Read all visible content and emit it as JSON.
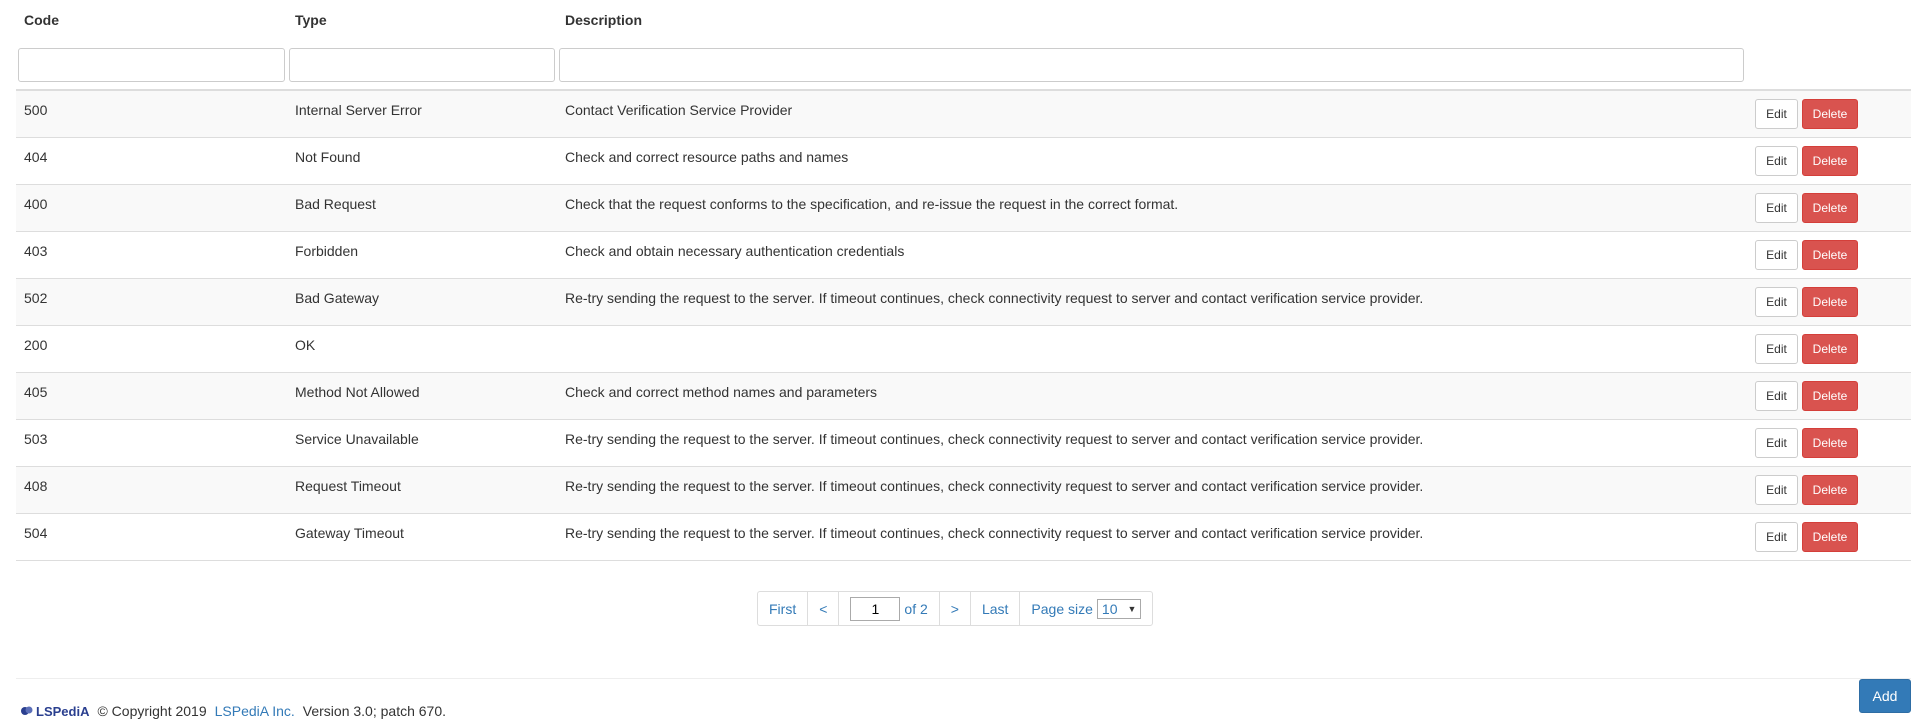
{
  "table": {
    "headers": {
      "code": "Code",
      "type": "Type",
      "description": "Description"
    },
    "rows": [
      {
        "code": "500",
        "type": "Internal Server Error",
        "description": "Contact Verification Service Provider"
      },
      {
        "code": "404",
        "type": "Not Found",
        "description": "Check and correct resource paths and names"
      },
      {
        "code": "400",
        "type": "Bad Request",
        "description": "Check that the request conforms to the specification, and re-issue the request in the correct format."
      },
      {
        "code": "403",
        "type": "Forbidden",
        "description": "Check and obtain necessary authentication credentials"
      },
      {
        "code": "502",
        "type": "Bad Gateway",
        "description": "Re-try sending the request to the server. If timeout continues, check connectivity request to server and contact verification service provider."
      },
      {
        "code": "200",
        "type": "OK",
        "description": ""
      },
      {
        "code": "405",
        "type": "Method Not Allowed",
        "description": "Check and correct method names and parameters"
      },
      {
        "code": "503",
        "type": "Service Unavailable",
        "description": "Re-try sending the request to the server. If timeout continues, check connectivity request to server and contact verification service provider."
      },
      {
        "code": "408",
        "type": "Request Timeout",
        "description": "Re-try sending the request to the server. If timeout continues, check connectivity request to server and contact verification service provider."
      },
      {
        "code": "504",
        "type": "Gateway Timeout",
        "description": "Re-try sending the request to the server. If timeout continues, check connectivity request to server and contact verification service provider."
      }
    ],
    "edit_label": "Edit",
    "delete_label": "Delete"
  },
  "pagination": {
    "first": "First",
    "prev": "<",
    "current_page": "1",
    "of_total": "of 2",
    "next": ">",
    "last": "Last",
    "page_size_label": "Page size",
    "page_size_value": "10"
  },
  "footer": {
    "logo_text": "LSPediA",
    "copyright": "© Copyright 2019",
    "company_link": "LSPediA Inc.",
    "version": "Version 3.0; patch 670."
  },
  "actions": {
    "add_label": "Add"
  },
  "colors": {
    "primary": "#337ab7",
    "danger": "#d9534f",
    "stripe": "#f9f9f9"
  }
}
